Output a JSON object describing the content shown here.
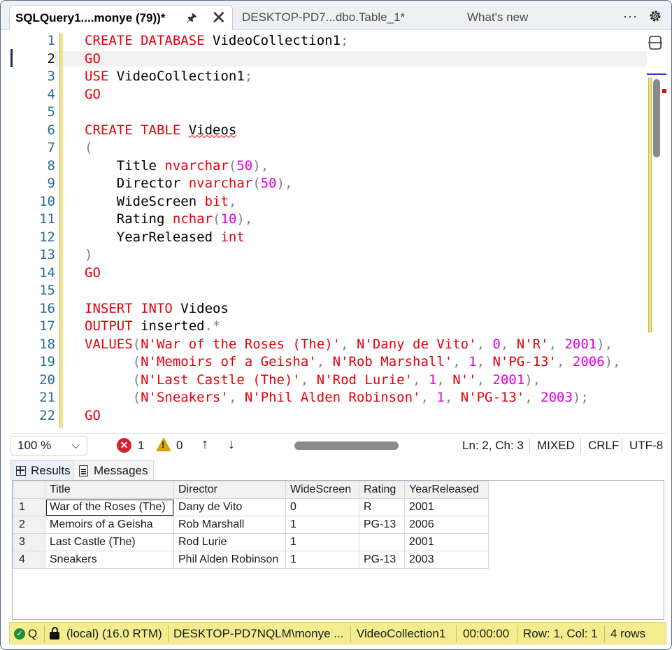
{
  "tabs": [
    {
      "label": "SQLQuery1....monye (79))*",
      "active": true
    },
    {
      "label": "DESKTOP-PD7...dbo.Table_1*",
      "active": false
    },
    {
      "label": "What's new",
      "active": false
    }
  ],
  "tab_actions": {
    "more": "···"
  },
  "editor": {
    "current_line": 2,
    "lines": [
      {
        "n": "1",
        "tokens": [
          {
            "t": "CREATE DATABASE",
            "c": "k"
          },
          {
            "t": " VideoCollection1"
          },
          {
            "t": ";",
            "c": "g"
          }
        ]
      },
      {
        "n": "2",
        "tokens": [
          {
            "t": "GO",
            "c": "k"
          }
        ]
      },
      {
        "n": "3",
        "tokens": [
          {
            "t": "USE",
            "c": "k"
          },
          {
            "t": " VideoCollection1"
          },
          {
            "t": ";",
            "c": "g"
          }
        ]
      },
      {
        "n": "4",
        "tokens": [
          {
            "t": "GO",
            "c": "k"
          }
        ]
      },
      {
        "n": "5",
        "tokens": []
      },
      {
        "n": "6",
        "tokens": [
          {
            "t": "CREATE TABLE",
            "c": "k"
          },
          {
            "t": " "
          },
          {
            "t": "Videos",
            "c": "squiggle"
          }
        ]
      },
      {
        "n": "7",
        "tokens": [
          {
            "t": "(",
            "c": "g"
          }
        ]
      },
      {
        "n": "8",
        "tokens": [
          {
            "t": "    Title "
          },
          {
            "t": "nvarchar",
            "c": "k"
          },
          {
            "t": "(",
            "c": "g"
          },
          {
            "t": "50",
            "c": "n"
          },
          {
            "t": "),",
            "c": "g"
          }
        ]
      },
      {
        "n": "9",
        "tokens": [
          {
            "t": "    Director "
          },
          {
            "t": "nvarchar",
            "c": "k"
          },
          {
            "t": "(",
            "c": "g"
          },
          {
            "t": "50",
            "c": "n"
          },
          {
            "t": "),",
            "c": "g"
          }
        ]
      },
      {
        "n": "10",
        "tokens": [
          {
            "t": "    WideScreen "
          },
          {
            "t": "bit",
            "c": "k"
          },
          {
            "t": ",",
            "c": "g"
          }
        ]
      },
      {
        "n": "11",
        "tokens": [
          {
            "t": "    Rating "
          },
          {
            "t": "nchar",
            "c": "k"
          },
          {
            "t": "(",
            "c": "g"
          },
          {
            "t": "10",
            "c": "n"
          },
          {
            "t": "),",
            "c": "g"
          }
        ]
      },
      {
        "n": "12",
        "tokens": [
          {
            "t": "    YearReleased "
          },
          {
            "t": "int",
            "c": "k"
          }
        ]
      },
      {
        "n": "13",
        "tokens": [
          {
            "t": ")",
            "c": "g"
          }
        ]
      },
      {
        "n": "14",
        "tokens": [
          {
            "t": "GO",
            "c": "k"
          }
        ]
      },
      {
        "n": "15",
        "tokens": []
      },
      {
        "n": "16",
        "tokens": [
          {
            "t": "INSERT INTO",
            "c": "k"
          },
          {
            "t": " Videos"
          }
        ]
      },
      {
        "n": "17",
        "tokens": [
          {
            "t": "OUTPUT",
            "c": "k"
          },
          {
            "t": " inserted"
          },
          {
            "t": ".*",
            "c": "g"
          }
        ]
      },
      {
        "n": "18",
        "tokens": [
          {
            "t": "VALUES",
            "c": "k"
          },
          {
            "t": "(",
            "c": "g"
          },
          {
            "t": "N'War of the Roses (The)'",
            "c": "s"
          },
          {
            "t": ", ",
            "c": "g"
          },
          {
            "t": "N'Dany de Vito'",
            "c": "s"
          },
          {
            "t": ", ",
            "c": "g"
          },
          {
            "t": "0",
            "c": "n"
          },
          {
            "t": ", ",
            "c": "g"
          },
          {
            "t": "N'R'",
            "c": "s"
          },
          {
            "t": ", ",
            "c": "g"
          },
          {
            "t": "2001",
            "c": "n"
          },
          {
            "t": "),",
            "c": "g"
          }
        ]
      },
      {
        "n": "19",
        "tokens": [
          {
            "t": "      "
          },
          {
            "t": "(",
            "c": "g"
          },
          {
            "t": "N'Memoirs of a Geisha'",
            "c": "s"
          },
          {
            "t": ", ",
            "c": "g"
          },
          {
            "t": "N'Rob Marshall'",
            "c": "s"
          },
          {
            "t": ", ",
            "c": "g"
          },
          {
            "t": "1",
            "c": "n"
          },
          {
            "t": ", ",
            "c": "g"
          },
          {
            "t": "N'PG-13'",
            "c": "s"
          },
          {
            "t": ", ",
            "c": "g"
          },
          {
            "t": "2006",
            "c": "n"
          },
          {
            "t": "),",
            "c": "g"
          }
        ]
      },
      {
        "n": "20",
        "tokens": [
          {
            "t": "      "
          },
          {
            "t": "(",
            "c": "g"
          },
          {
            "t": "N'Last Castle (The)'",
            "c": "s"
          },
          {
            "t": ", ",
            "c": "g"
          },
          {
            "t": "N'Rod Lurie'",
            "c": "s"
          },
          {
            "t": ", ",
            "c": "g"
          },
          {
            "t": "1",
            "c": "n"
          },
          {
            "t": ", ",
            "c": "g"
          },
          {
            "t": "N''",
            "c": "s"
          },
          {
            "t": ", ",
            "c": "g"
          },
          {
            "t": "2001",
            "c": "n"
          },
          {
            "t": "),",
            "c": "g"
          }
        ]
      },
      {
        "n": "21",
        "tokens": [
          {
            "t": "      "
          },
          {
            "t": "(",
            "c": "g"
          },
          {
            "t": "N'Sneakers'",
            "c": "s"
          },
          {
            "t": ", ",
            "c": "g"
          },
          {
            "t": "N'Phil Alden Robinson'",
            "c": "s"
          },
          {
            "t": ", ",
            "c": "g"
          },
          {
            "t": "1",
            "c": "n"
          },
          {
            "t": ", ",
            "c": "g"
          },
          {
            "t": "N'PG-13'",
            "c": "s"
          },
          {
            "t": ", ",
            "c": "g"
          },
          {
            "t": "2003",
            "c": "n"
          },
          {
            "t": ");",
            "c": "g"
          }
        ]
      },
      {
        "n": "22",
        "tokens": [
          {
            "t": "GO",
            "c": "k"
          }
        ]
      }
    ]
  },
  "editor_status": {
    "zoom": "100 %",
    "errors": "1",
    "warnings": "0",
    "position": "Ln: 2, Ch: 3",
    "line_endings_mode": "MIXED",
    "line_ending": "CRLF",
    "encoding": "UTF-8"
  },
  "results_tabs": {
    "results": "Results",
    "messages": "Messages"
  },
  "results": {
    "columns": [
      "Title",
      "Director",
      "WideScreen",
      "Rating",
      "YearReleased"
    ],
    "rows": [
      [
        "1",
        "War of the Roses (The)",
        "Dany de Vito",
        "0",
        "R",
        "2001"
      ],
      [
        "2",
        "Memoirs of a Geisha",
        "Rob Marshall",
        "1",
        "PG-13",
        "2006"
      ],
      [
        "3",
        "Last Castle (The)",
        "Rod Lurie",
        "1",
        "",
        "2001"
      ],
      [
        "4",
        "Sneakers",
        "Phil Alden Robinson",
        "1",
        "PG-13",
        "2003"
      ]
    ]
  },
  "status_bar": {
    "state": "Q",
    "server": "(local) (16.0 RTM)",
    "login": "DESKTOP-PD7NQLM\\monye ...",
    "database": "VideoCollection1",
    "elapsed": "00:00:00",
    "cursor": "Row: 1, Col: 1",
    "row_count": "4 rows"
  },
  "colors": {
    "keyword": "#e8000b",
    "number": "#e100e1",
    "status_bar": "#f4ec8e",
    "error": "#d8202d",
    "warning": "#d9a200"
  }
}
